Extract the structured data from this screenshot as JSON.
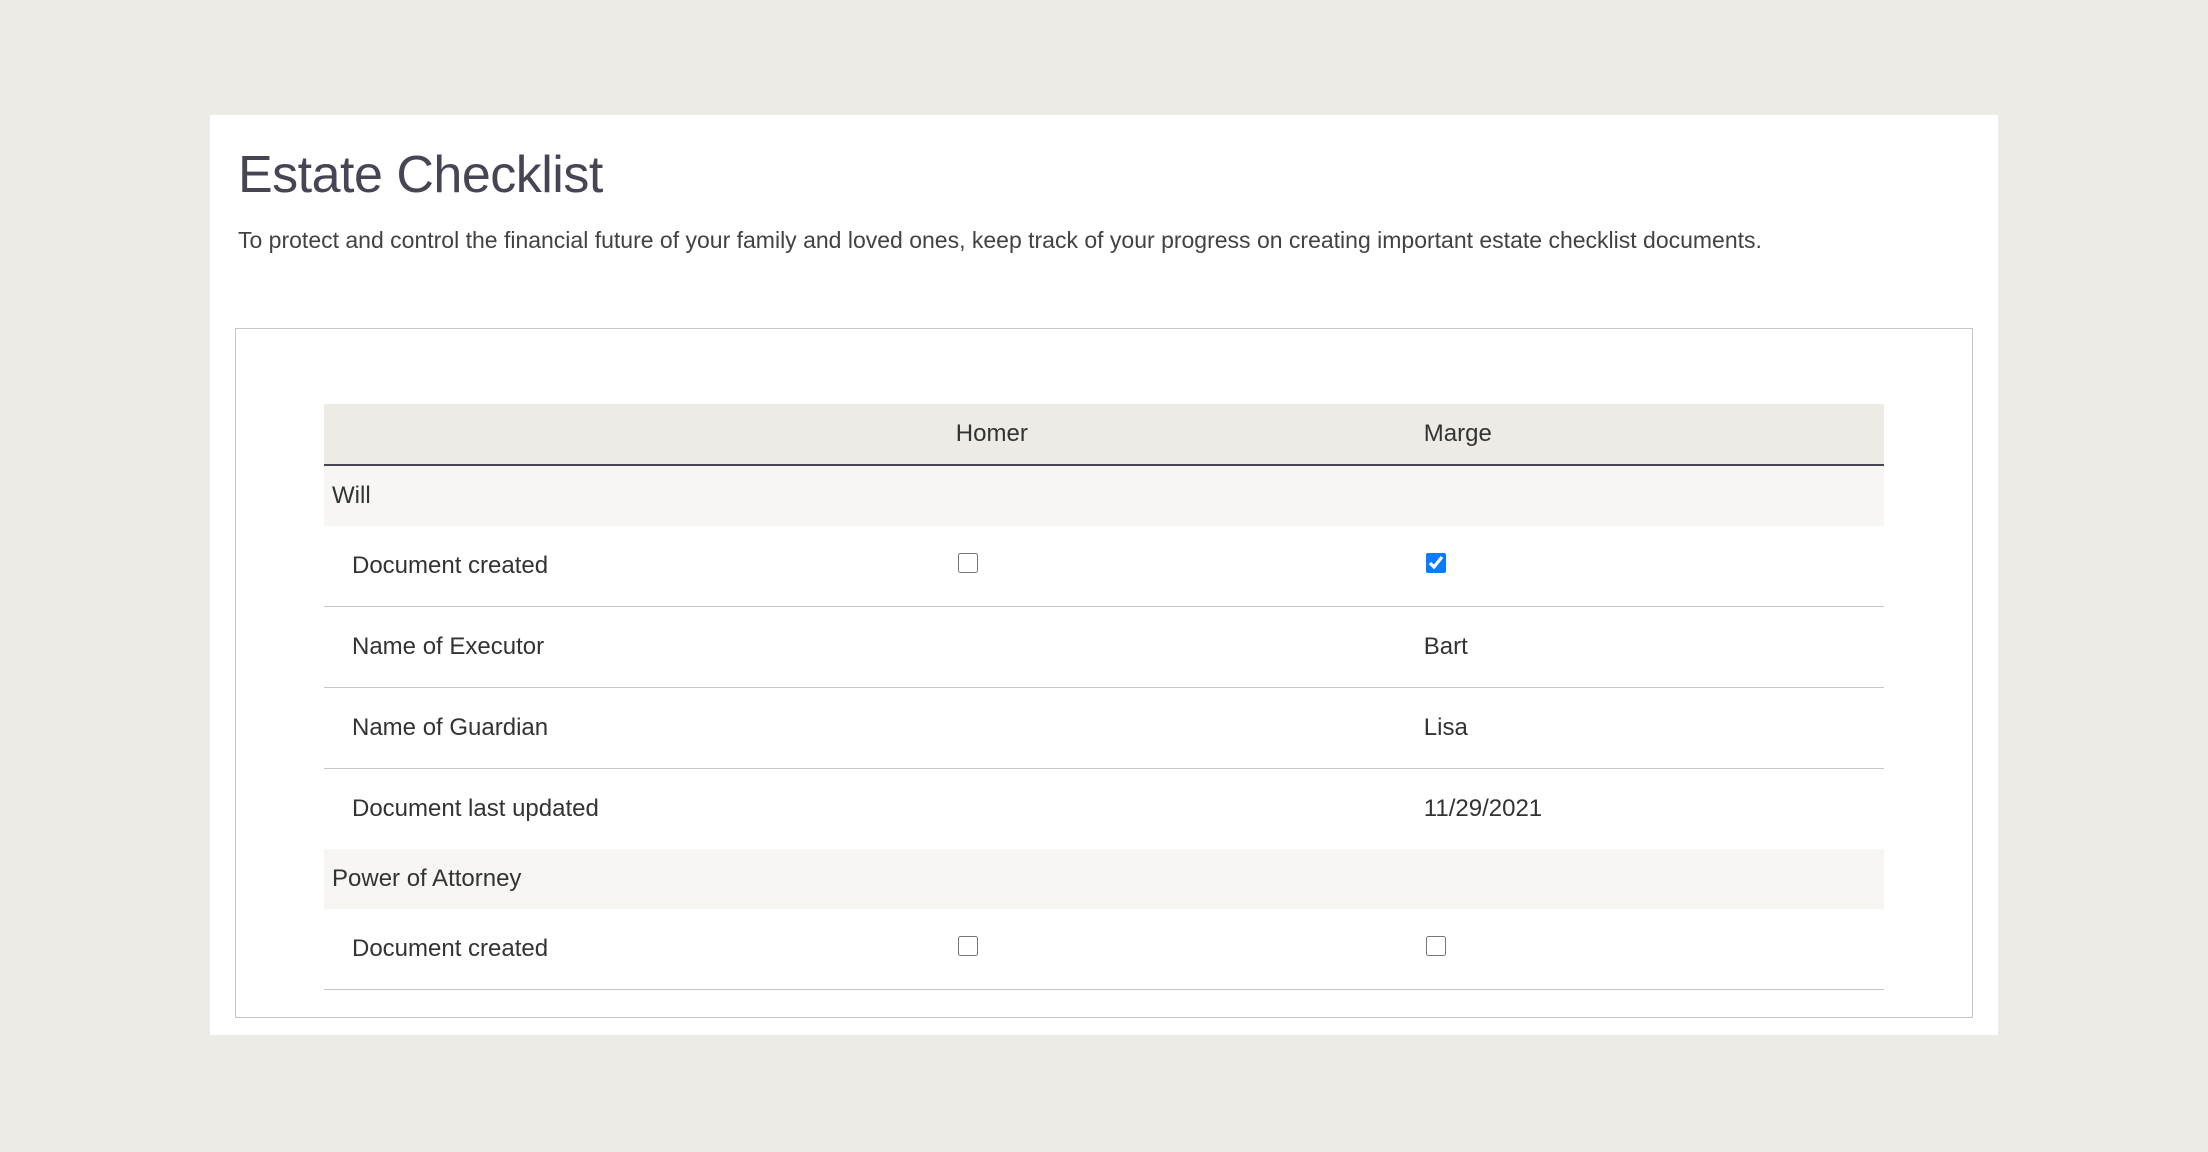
{
  "header": {
    "title": "Estate Checklist",
    "subtitle": "To protect and control the financial future of your family and loved ones, keep track of your progress on creating important estate checklist documents."
  },
  "table": {
    "columns": {
      "person1": "Homer",
      "person2": "Marge"
    },
    "sections": [
      {
        "name": "Will",
        "rows": [
          {
            "label": "Document created",
            "type": "checkbox",
            "person1_checked": false,
            "person2_checked": true
          },
          {
            "label": "Name of Executor",
            "type": "text",
            "person1_value": "",
            "person2_value": "Bart"
          },
          {
            "label": "Name of Guardian",
            "type": "text",
            "person1_value": "",
            "person2_value": "Lisa"
          },
          {
            "label": "Document last updated",
            "type": "text",
            "person1_value": "",
            "person2_value": "11/29/2021",
            "last_in_section": true
          }
        ]
      },
      {
        "name": "Power of Attorney",
        "rows": [
          {
            "label": "Document created",
            "type": "checkbox",
            "person1_checked": false,
            "person2_checked": false
          }
        ]
      }
    ]
  }
}
